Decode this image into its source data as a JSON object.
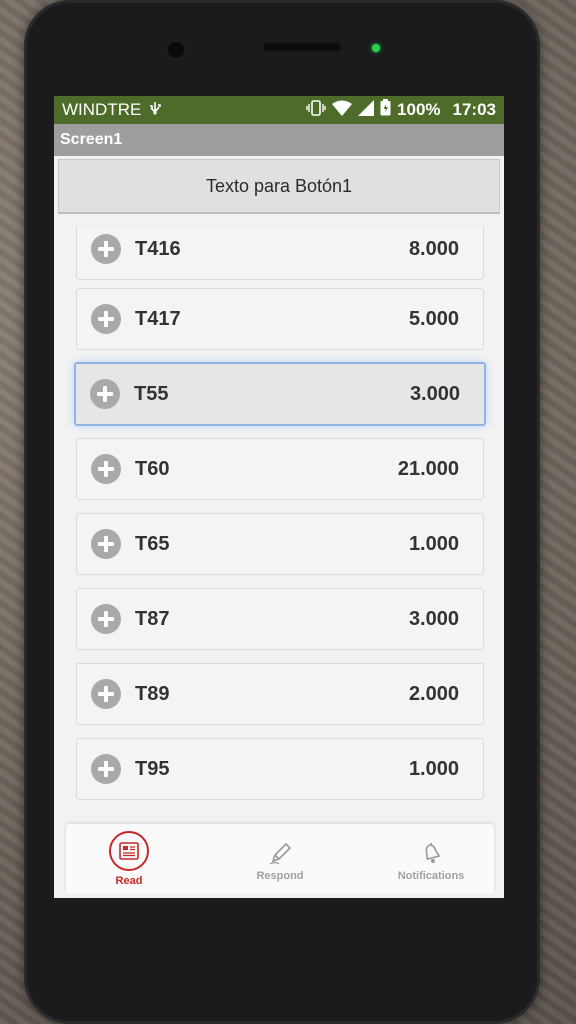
{
  "statusbar": {
    "carrier": "WINDTRE",
    "battery": "100%",
    "time": "17:03"
  },
  "titlebar": {
    "title": "Screen1"
  },
  "top_button": {
    "label": "Texto para Botón1"
  },
  "list": {
    "items": [
      {
        "code": "T416",
        "value": "8.000"
      },
      {
        "code": "T417",
        "value": "5.000"
      },
      {
        "code": "T55",
        "value": "3.000",
        "selected": true
      },
      {
        "code": "T60",
        "value": "21.000"
      },
      {
        "code": "T65",
        "value": "1.000"
      },
      {
        "code": "T87",
        "value": "3.000"
      },
      {
        "code": "T89",
        "value": "2.000"
      },
      {
        "code": "T95",
        "value": "1.000"
      }
    ]
  },
  "bottomnav": {
    "read": {
      "label": "Read",
      "icon": "news-icon"
    },
    "respond": {
      "label": "Respond",
      "icon": "pencil-icon"
    },
    "notifications": {
      "label": "Notifications",
      "icon": "bell-icon"
    }
  },
  "colors": {
    "statusbar": "#4e6b2a",
    "titlebar": "#9e9e9e",
    "accent": "#c62828",
    "selection": "#8fb5e6"
  }
}
